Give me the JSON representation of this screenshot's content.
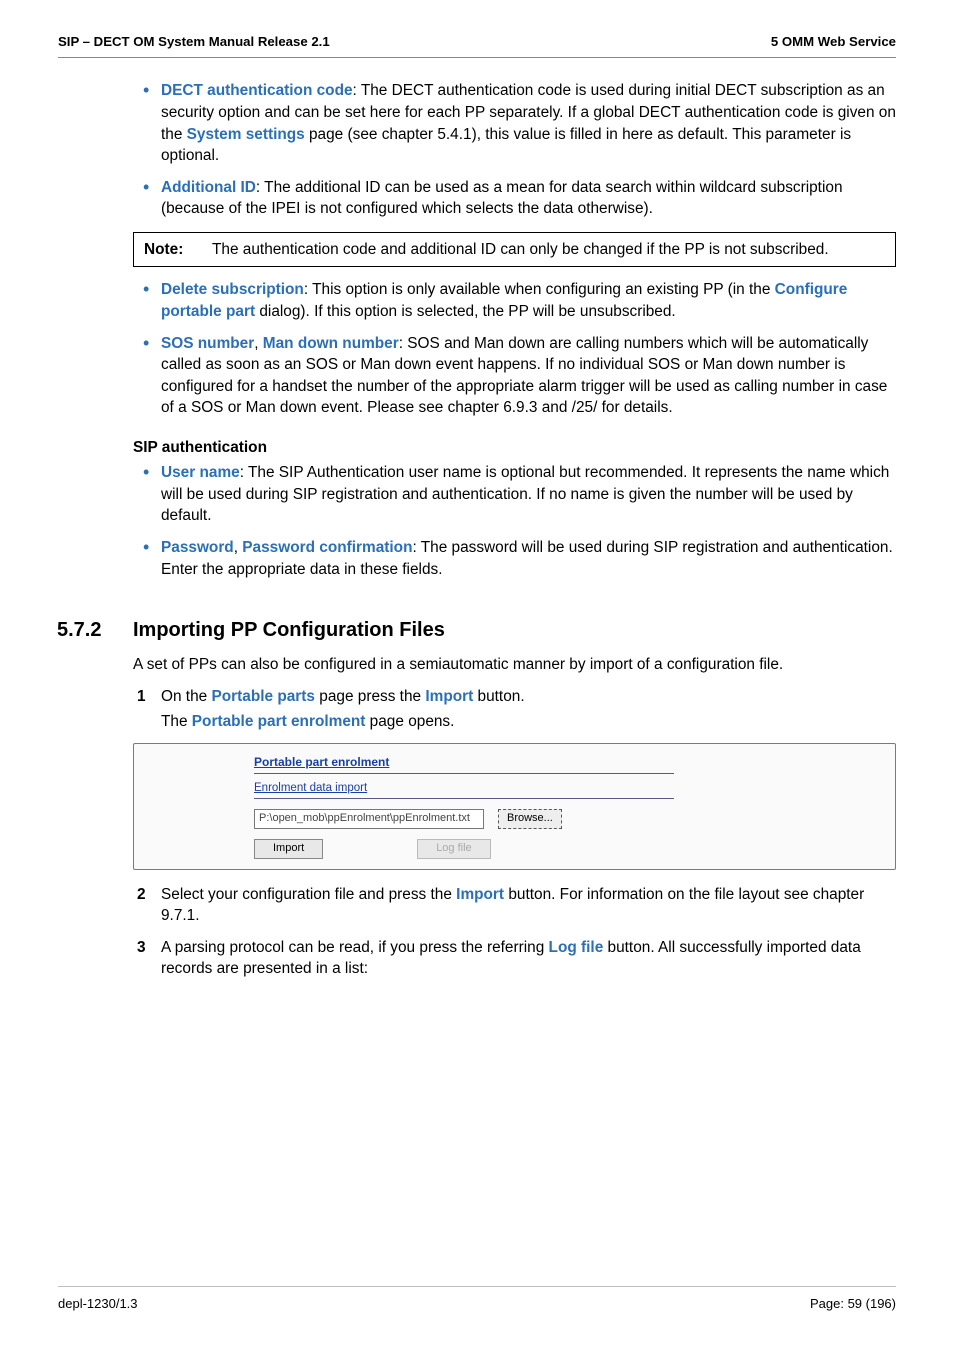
{
  "header": {
    "left": "SIP – DECT OM System Manual Release 2.1",
    "right": "5 OMM Web Service"
  },
  "bullets1": {
    "b1": {
      "term": "DECT authentication code",
      "text_a": ": The DECT authentication code is used during initial DECT subscription as an security option and can be set here for each PP separately. If a global DECT authentication code is given on the ",
      "link": "System settings",
      "text_b": " page (see chapter 5.4.1), this value is filled in here as default. This parameter is optional."
    },
    "b2": {
      "term": "Additional ID",
      "text": ": The additional ID can be used as a mean for data search within wildcard subscription (because of the IPEI is not configured which selects the data otherwise)."
    }
  },
  "note": {
    "label": "Note:",
    "text": "The authentication code and additional ID can only be changed if the PP is not subscribed."
  },
  "bullets2": {
    "b3": {
      "term": "Delete subscription",
      "text_a": ": This option is only available when configuring an existing PP (in the ",
      "link": "Configure portable part",
      "text_b": " dialog). If this option is selected, the PP will be unsubscribed."
    },
    "b4": {
      "term1": "SOS number",
      "sep": ", ",
      "term2": "Man down number",
      "text": ": SOS and Man down are calling numbers which will be automatically called as soon as an SOS or Man down event happens. If no individual SOS or Man down number is configured for a handset the number of the appropriate alarm trigger will be used as calling number in case of a SOS or Man down event. Please see chapter 6.9.3 and /25/ for details."
    }
  },
  "subhead": "SIP authentication",
  "bullets3": {
    "b5": {
      "term": "User name",
      "text": ": The SIP Authentication user name is optional but recommended. It represents the name which will be used during SIP registration and authentication. If no name is given the number will be used by default."
    },
    "b6": {
      "term1": "Password",
      "sep": ", ",
      "term2": "Password confirmation",
      "text": ": The password will be used during SIP registration and authentication. Enter the appropriate data in these fields."
    }
  },
  "h2": {
    "num": "5.7.2",
    "title": "Importing PP Configuration Files"
  },
  "intro": "A set of PPs can also be configured in a semiautomatic manner by import of a configuration file.",
  "steps": {
    "s1": {
      "a": "On the ",
      "link1": "Portable parts",
      "b": " page press the ",
      "link2": "Import",
      "c": " button.",
      "line2a": "The ",
      "line2link": "Portable part enrolment",
      "line2b": " page opens."
    },
    "s2": {
      "a": "Select your configuration file and press the ",
      "link": "Import",
      "b": " button. For information on the file layout see chapter 9.7.1."
    },
    "s3": {
      "a": "A parsing protocol can be read, if you press the referring ",
      "link": "Log file",
      "b": " button. All successfully imported data records are presented in a list:"
    }
  },
  "figure": {
    "title": "Portable part enrolment",
    "subtitle": "Enrolment data import",
    "path": "P:\\open_mob\\ppEnrolment\\ppEnrolment.txt",
    "browse": "Browse...",
    "importBtn": "Import",
    "logBtn": "Log file"
  },
  "footer": {
    "left": "depl-1230/1.3",
    "right": "Page: 59 (196)"
  }
}
